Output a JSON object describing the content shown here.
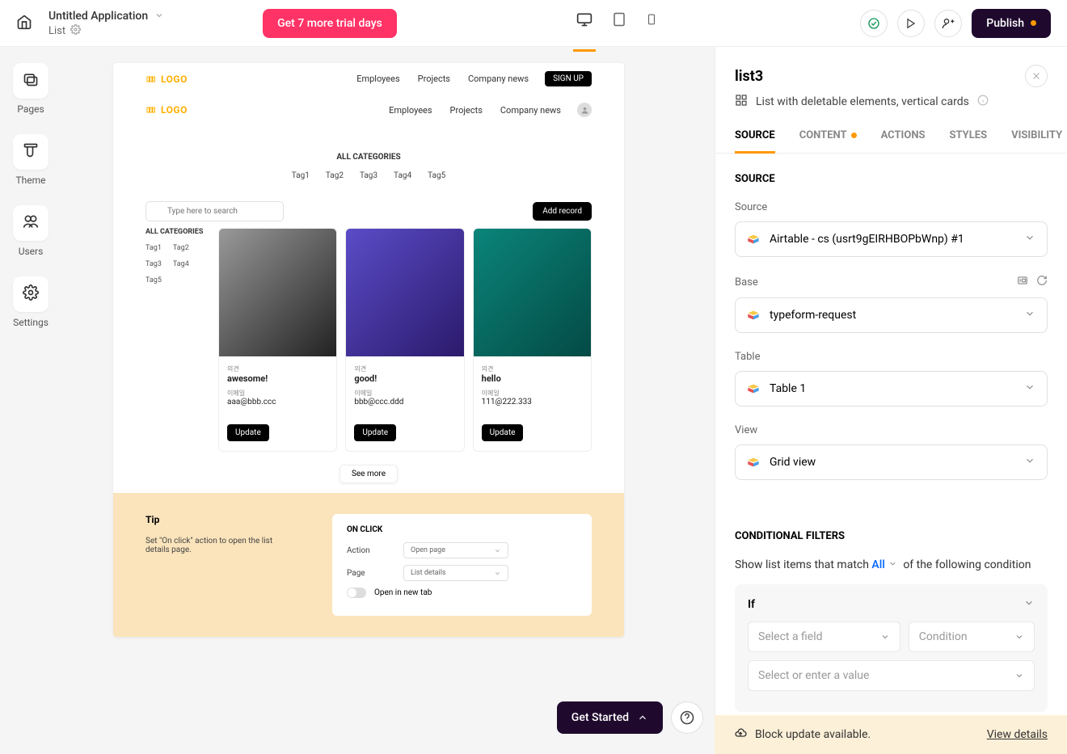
{
  "header": {
    "app_title": "Untitled Application",
    "breadcrumb": "List",
    "trial_button": "Get 7 more trial days",
    "publish": "Publish"
  },
  "leftbar": {
    "pages": "Pages",
    "theme": "Theme",
    "users": "Users",
    "settings": "Settings"
  },
  "canvas": {
    "logo": "LOGO",
    "nav": {
      "employees": "Employees",
      "projects": "Projects",
      "news": "Company news"
    },
    "signup": "SIGN UP",
    "categories_title": "ALL CATEGORIES",
    "tags": [
      "Tag1",
      "Tag2",
      "Tag3",
      "Tag4",
      "Tag5"
    ],
    "search_placeholder": "Type here to search",
    "add_record": "Add record",
    "side_cats_title": "ALL CATEGORIES",
    "cards": [
      {
        "opinion_label": "의견",
        "opinion": "awesome!",
        "email_label": "이메일",
        "email": "aaa@bbb.ccc",
        "btn": "Update"
      },
      {
        "opinion_label": "의견",
        "opinion": "good!",
        "email_label": "이메일",
        "email": "bbb@ccc.ddd",
        "btn": "Update"
      },
      {
        "opinion_label": "의견",
        "opinion": "hello",
        "email_label": "이메일",
        "email": "111@222.333",
        "btn": "Update"
      }
    ],
    "see_more": "See more",
    "tip": {
      "title": "Tip",
      "text": "Set \"On click\" action to open the list details page.",
      "onclick": "ON CLICK",
      "action": "Action",
      "action_val": "Open page",
      "page": "Page",
      "page_val": "List details",
      "newtab": "Open in new tab"
    }
  },
  "get_started": "Get Started",
  "right": {
    "title": "list3",
    "subtitle": "List with deletable elements, vertical cards",
    "tabs": {
      "source": "SOURCE",
      "content": "CONTENT",
      "actions": "ACTIONS",
      "styles": "STYLES",
      "visibility": "VISIBILITY"
    },
    "source_section": "SOURCE",
    "source_label": "Source",
    "source_value": "Airtable - cs (usrt9gEIRHBOPbWnp) #1",
    "base_label": "Base",
    "base_value": "typeform-request",
    "table_label": "Table",
    "table_value": "Table 1",
    "view_label": "View",
    "view_value": "Grid view",
    "cond_title": "CONDITIONAL FILTERS",
    "cond_text_pre": "Show list items that match ",
    "cond_all": "All",
    "cond_text_post": " of the following condition",
    "if_label": "If",
    "select_field": "Select a field",
    "condition": "Condition",
    "select_value": "Select or enter a value"
  },
  "banner": {
    "text": "Block update available.",
    "link": "View details"
  }
}
